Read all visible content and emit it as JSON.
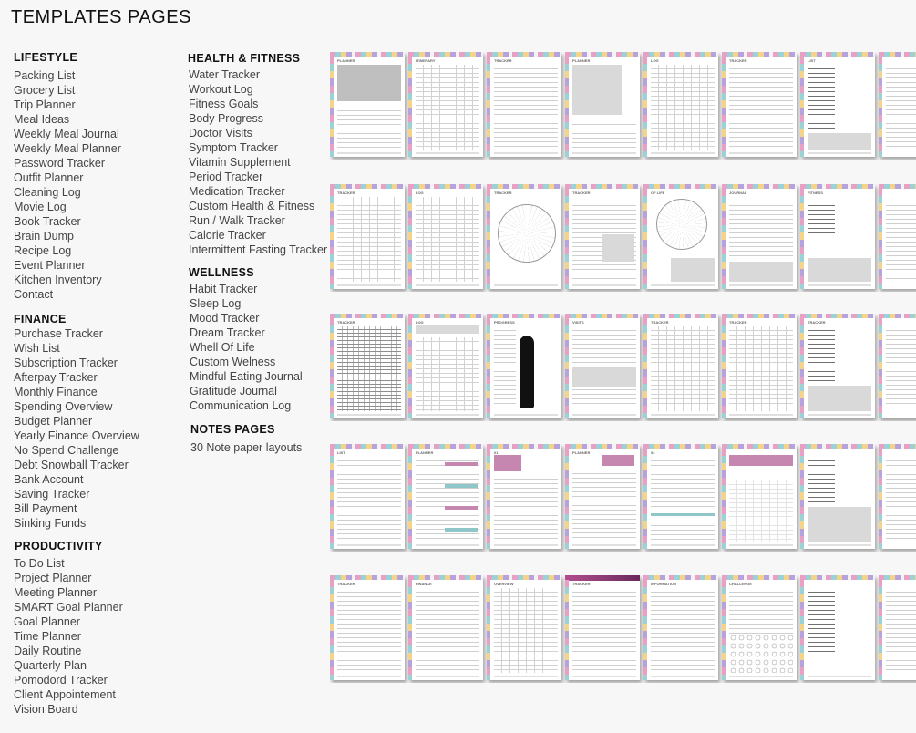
{
  "page_title": "TEMPLATES PAGES",
  "sections": {
    "lifestyle": {
      "heading": "LIFESTYLE",
      "items": [
        "Packing List",
        "Grocery List",
        "Trip Planner",
        "Meal Ideas",
        "Weekly Meal Journal",
        "Weekly Meal Planner",
        "Password Tracker",
        "Outfit Planner",
        "Cleaning Log",
        "Movie Log",
        "Book Tracker",
        "Brain Dump",
        "Recipe Log",
        "Event Planner",
        "Kitchen Inventory",
        "Contact"
      ]
    },
    "finance": {
      "heading": "FINANCE",
      "items": [
        "Purchase Tracker",
        "Wish List",
        "Subscription Tracker",
        "Afterpay Tracker",
        "Monthly Finance",
        "Spending Overview",
        "Budget Planner",
        "Yearly Finance Overview",
        "No Spend Challenge",
        "Debt Snowball Tracker",
        "Bank Account",
        "Saving Tracker",
        "Bill Payment",
        "Sinking Funds"
      ]
    },
    "productivity": {
      "heading": "PRODUCTIVITY",
      "items": [
        "To Do List",
        "Project Planner",
        "Meeting Planner",
        "SMART Goal Planner",
        "Goal Planner",
        "Time Planner",
        "Daily Routine",
        "Quarterly Plan",
        "Pomodord Tracker",
        "Client Appointement",
        "Vision Board"
      ]
    },
    "health": {
      "heading": "HEALTH & FITNESS",
      "items": [
        "Water Tracker",
        "Workout Log",
        "Fitness Goals",
        "Body Progress",
        "Doctor Visits",
        "Symptom Tracker",
        "Vitamin Supplement",
        "Period Tracker",
        "Medication Tracker",
        "Custom Health & Fitness",
        "Run / Walk Tracker",
        "Calorie Tracker",
        "Intermittent Fasting Tracker"
      ]
    },
    "wellness": {
      "heading": "WELLNESS",
      "items": [
        "Habit Tracker",
        "Sleep Log",
        "Mood Tracker",
        "Dream Tracker",
        "Whell Of Life",
        "Custom Welness",
        "Mindful Eating Journal",
        "Gratitude Journal",
        "Communication Log"
      ]
    },
    "notes": {
      "heading": "NOTES PAGES",
      "items": [
        "30 Note paper layouts"
      ]
    }
  },
  "thumbnail_rows": [
    [
      "PLANNER",
      "ITINERARY",
      "TRACKER",
      "PLANNER",
      "LOG",
      "TRACKER",
      "LIST"
    ],
    [
      "TRACKER",
      "LOG",
      "TRACKER",
      "TRACKER",
      "OF LIFE",
      "JOURNAL",
      "FITNESS"
    ],
    [
      "TRACKER",
      "LOG",
      "PROGRESS",
      "VISITS",
      "TRACKER",
      "TRACKER",
      "TRACKER"
    ],
    [
      "LIST",
      "PLANNER",
      "01",
      "PLANNER",
      "02",
      "",
      ""
    ],
    [
      "TRACKER",
      "FINANCE",
      "OVERVIEW",
      "TRACKER",
      "INFORMATION",
      "CHALLENGE",
      ""
    ]
  ],
  "colors": {
    "pink_accent": "#c586b0",
    "background": "#f7f7f7"
  }
}
